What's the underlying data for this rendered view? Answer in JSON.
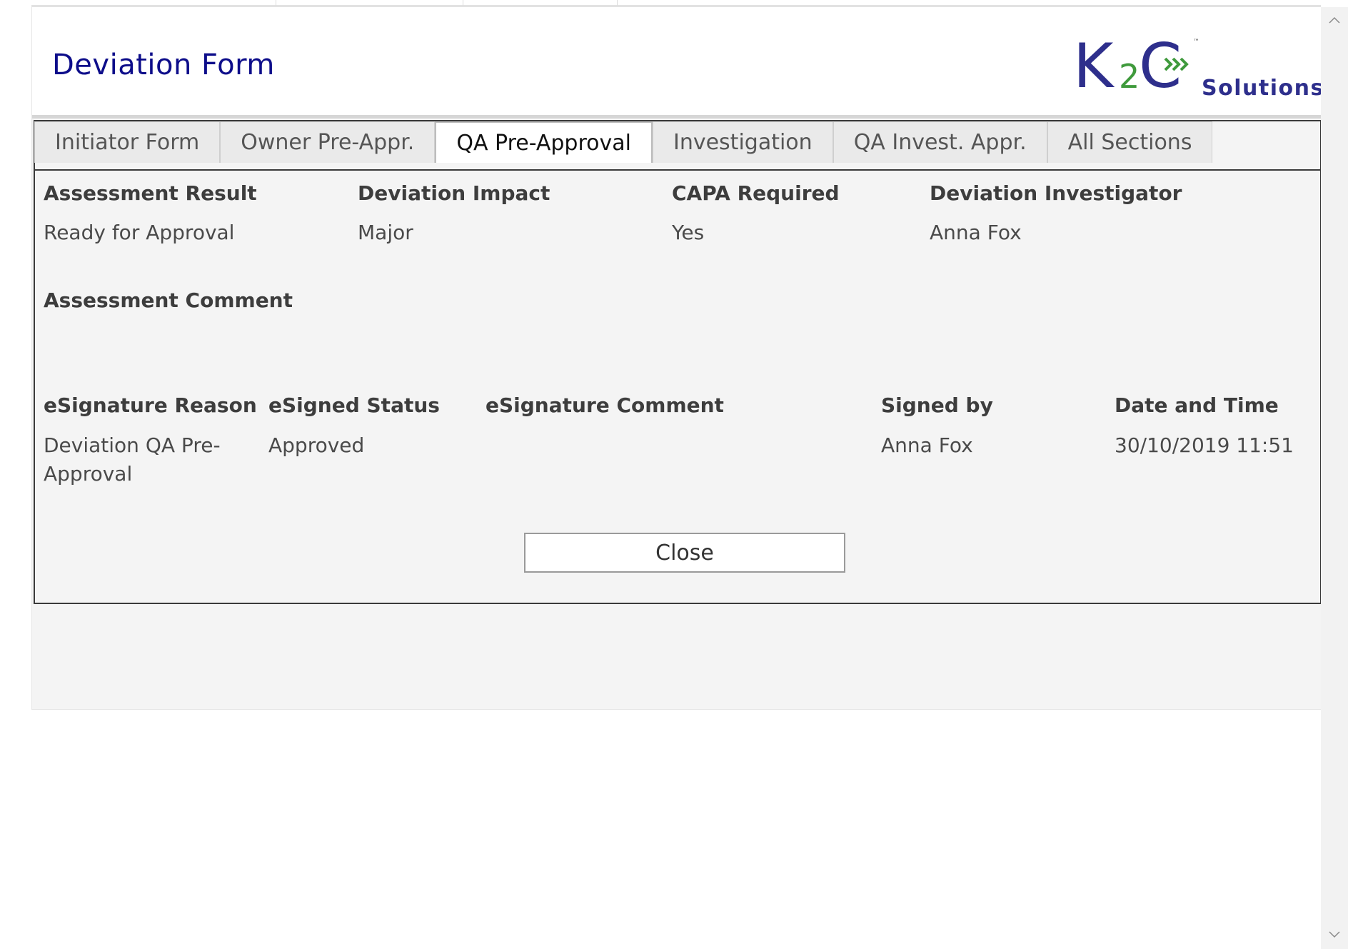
{
  "header": {
    "title": "Deviation Form",
    "logo": {
      "k": "K",
      "two": "2",
      "c": "C",
      "tm": "™",
      "tagline": "Solutions",
      "colors": {
        "primary": "#2e2f8c",
        "accent": "#3f9a3c"
      }
    }
  },
  "tabs": [
    {
      "label": "Initiator Form",
      "active": false
    },
    {
      "label": "Owner Pre-Appr.",
      "active": false
    },
    {
      "label": "QA Pre-Approval",
      "active": true
    },
    {
      "label": "Investigation",
      "active": false
    },
    {
      "label": "QA Invest. Appr.",
      "active": false
    },
    {
      "label": "All Sections",
      "active": false
    }
  ],
  "assessment": {
    "result_label": "Assessment Result",
    "result_value": "Ready for Approval",
    "impact_label": "Deviation Impact",
    "impact_value": "Major",
    "capa_label": "CAPA Required",
    "capa_value": "Yes",
    "investigator_label": "Deviation Investigator",
    "investigator_value": "Anna Fox",
    "comment_label": "Assessment Comment",
    "comment_value": ""
  },
  "esignature": {
    "reason_label": "eSignature Reason",
    "reason_value": "Deviation QA Pre-Approval",
    "status_label": "eSigned Status",
    "status_value": "Approved",
    "comment_label": "eSignature Comment",
    "comment_value": "",
    "signed_by_label": "Signed by",
    "signed_by_value": "Anna Fox",
    "datetime_label": "Date and Time",
    "datetime_value": "30/10/2019 11:51"
  },
  "actions": {
    "close_label": "Close"
  },
  "icons": {
    "logo_arrows": "triple-chevron-right-icon",
    "scroll_up": "chevron-up-icon",
    "scroll_down": "chevron-down-icon"
  }
}
